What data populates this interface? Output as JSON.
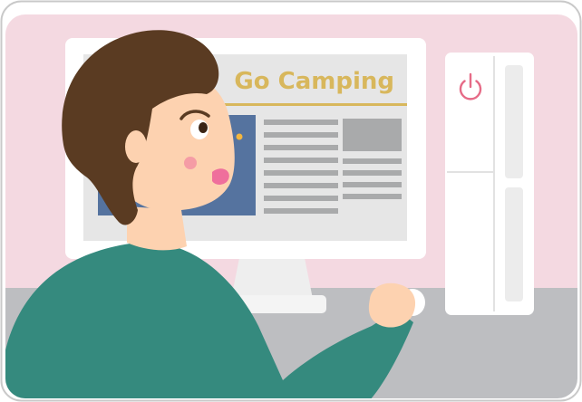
{
  "scene": {
    "name": "person-using-desktop-computer",
    "monitor": {
      "headline": "Go Camping"
    },
    "pc_tower": {
      "power_icon": "power-icon"
    }
  },
  "colors": {
    "wall": "#f4d9e1",
    "desk": "#bdbec1",
    "monitor_frame": "#ffffff",
    "screen_bg": "#e6e6e6",
    "headline": "#d8b75c",
    "accent_line": "#d8b75c",
    "photo_blue": "#55739f",
    "text_lines": "#a9aaab",
    "shirt": "#358a7e",
    "hair": "#5a3b22",
    "skin": "#fdd2b0",
    "cheek": "#ef6f9c",
    "power": "#e66b87",
    "outline": "#c9c9c9"
  }
}
